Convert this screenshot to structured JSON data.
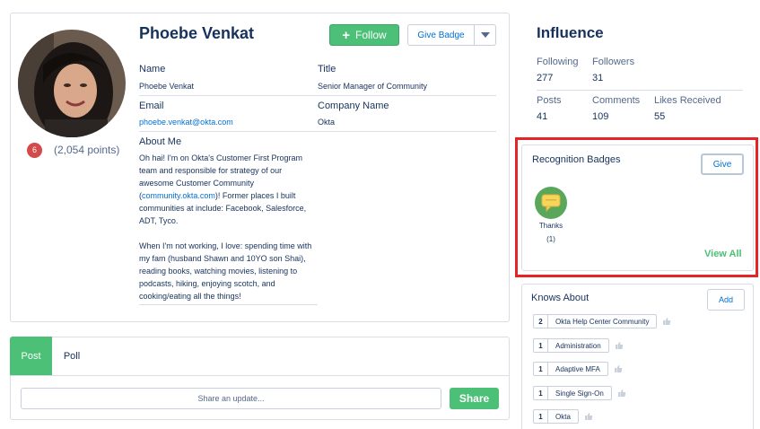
{
  "profile": {
    "name": "Phoebe Venkat",
    "rank": "6",
    "points": "(2,054 points)",
    "follow_label": "Follow",
    "give_badge_label": "Give Badge",
    "fields": {
      "name_label": "Name",
      "name_value": "Phoebe Venkat",
      "title_label": "Title",
      "title_value": "Senior Manager of Community",
      "email_label": "Email",
      "email_value": "phoebe.venkat@okta.com",
      "company_label": "Company Name",
      "company_value": "Okta"
    },
    "about_label": "About Me",
    "about_p1_before": "Oh hai! I'm on Okta's Customer First Program team and responsible for strategy of our awesome Customer Community (",
    "about_p1_link": "community.okta.com",
    "about_p1_after": ")! Former places I built communities at include: Facebook, Salesforce, ADT, Tyco.",
    "about_p2": "When I'm not working, I love: spending time with my fam (husband Shawn and 10YO son Shai), reading books, watching movies, listening to podcasts, hiking, enjoying scotch, and cooking/eating all the things!"
  },
  "composer": {
    "tab_post": "Post",
    "tab_poll": "Poll",
    "placeholder": "Share an update...",
    "share_label": "Share"
  },
  "influence": {
    "title": "Influence",
    "following_label": "Following",
    "following_value": "277",
    "followers_label": "Followers",
    "followers_value": "31",
    "posts_label": "Posts",
    "posts_value": "41",
    "comments_label": "Comments",
    "comments_value": "109",
    "likes_label": "Likes Received",
    "likes_value": "55"
  },
  "badges": {
    "title": "Recognition Badges",
    "give_label": "Give",
    "items": [
      {
        "label": "Thanks",
        "count": "(1)",
        "icon": "chat-bubble-icon"
      }
    ],
    "view_all_label": "View All",
    "highlight_color": "#e52525"
  },
  "knows_about": {
    "title": "Knows About",
    "add_label": "Add",
    "topics": [
      {
        "count": "2",
        "name": "Okta Help Center Community"
      },
      {
        "count": "1",
        "name": "Administration"
      },
      {
        "count": "1",
        "name": "Adaptive MFA"
      },
      {
        "count": "1",
        "name": "Single Sign-On"
      },
      {
        "count": "1",
        "name": "Okta"
      }
    ]
  },
  "colors": {
    "accent_green": "#4bc076",
    "link_blue": "#0070d2",
    "text_navy": "#16325c"
  }
}
